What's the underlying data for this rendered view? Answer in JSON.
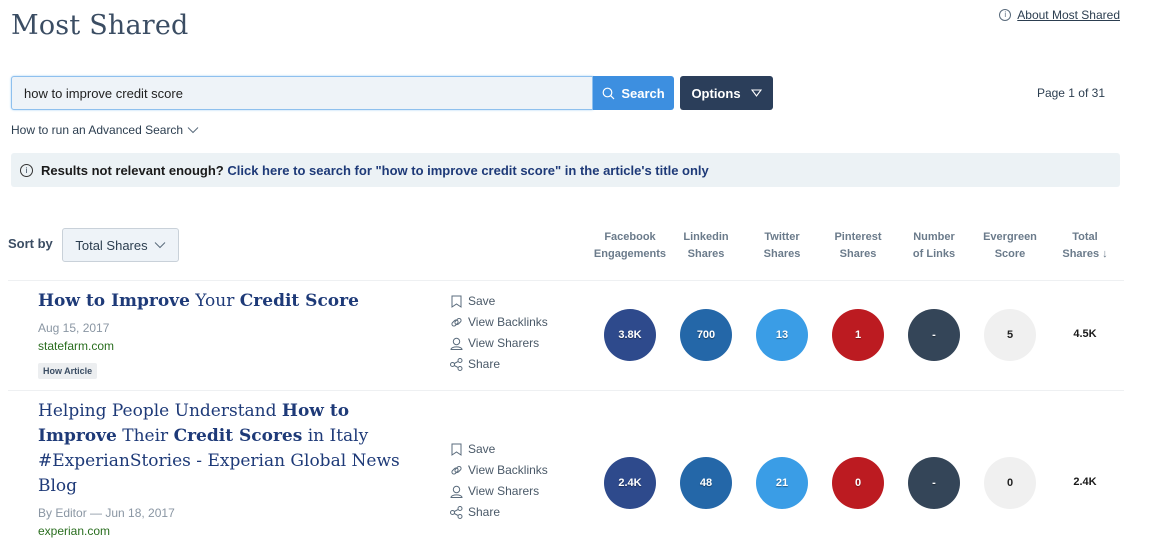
{
  "header": {
    "title": "Most Shared",
    "about_link": "About Most Shared"
  },
  "search": {
    "value": "how to improve credit score",
    "placeholder": "",
    "search_label": "Search",
    "options_label": "Options",
    "advanced_label": "How to run an Advanced Search",
    "page_info": "Page 1 of 31"
  },
  "notice": {
    "plain": "Results not relevant enough?",
    "link": "Click here to search for \"how to improve credit score\" in the article's title only"
  },
  "sort": {
    "label": "Sort by",
    "selected": "Total Shares"
  },
  "columns": [
    {
      "line1": "Facebook",
      "line2": "Engagements"
    },
    {
      "line1": "Linkedin",
      "line2": "Shares"
    },
    {
      "line1": "Twitter",
      "line2": "Shares"
    },
    {
      "line1": "Pinterest",
      "line2": "Shares"
    },
    {
      "line1": "Number",
      "line2": "of Links"
    },
    {
      "line1": "Evergreen",
      "line2": "Score"
    },
    {
      "line1": "Total",
      "line2": "Shares ↓"
    }
  ],
  "colors": {
    "facebook": "#2e4a8c",
    "linkedin": "#2467a8",
    "twitter": "#3a9de6",
    "pinterest": "#bc1b21",
    "links": "#344558",
    "evergreen": "#f0f0f0"
  },
  "actions": {
    "save": "Save",
    "backlinks": "View Backlinks",
    "sharers": "View Sharers",
    "share": "Share"
  },
  "results": [
    {
      "title_parts": [
        {
          "text": "How to Improve",
          "bold": true
        },
        {
          "text": " Your ",
          "bold": false
        },
        {
          "text": "Credit Score",
          "bold": true
        }
      ],
      "meta": "Aug 15, 2017",
      "domain": "statefarm.com",
      "tag": "How Article",
      "facebook": "3.8K",
      "linkedin": "700",
      "twitter": "13",
      "pinterest": "1",
      "links": "-",
      "evergreen": "5",
      "total": "4.5K"
    },
    {
      "title_parts": [
        {
          "text": "Helping People Understand ",
          "bold": false
        },
        {
          "text": "How to Improve",
          "bold": true
        },
        {
          "text": " Their ",
          "bold": false
        },
        {
          "text": "Credit Scores",
          "bold": true
        },
        {
          "text": " in Italy #ExperianStories - Experian Global News Blog",
          "bold": false
        }
      ],
      "meta": "By Editor — Jun 18, 2017",
      "domain": "experian.com",
      "facebook": "2.4K",
      "linkedin": "48",
      "twitter": "21",
      "pinterest": "0",
      "links": "-",
      "evergreen": "0",
      "total": "2.4K"
    }
  ]
}
